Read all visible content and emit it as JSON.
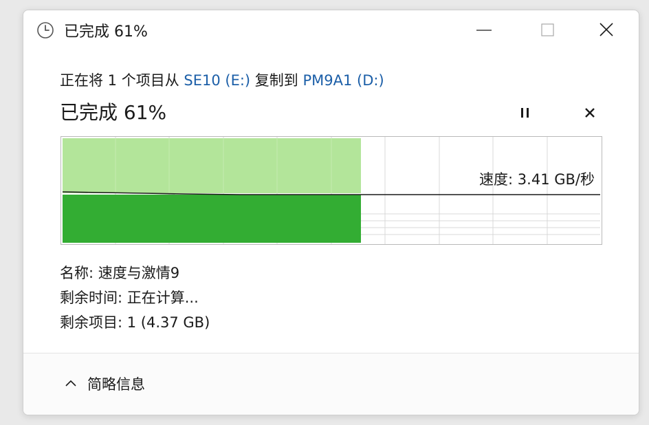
{
  "window": {
    "title": "已完成 61%",
    "controls": {
      "minimize": "minimize-icon",
      "maximize": "maximize-icon",
      "close": "close-icon"
    }
  },
  "copy": {
    "prefix": "正在将 1 个项目从 ",
    "source": "SE10 (E:)",
    "middle": " 复制到 ",
    "destination": "PM9A1 (D:)"
  },
  "progress": {
    "label": "已完成 61%",
    "percent": 61
  },
  "graph": {
    "speed_label": "速度: 3.41 GB/秒",
    "colors": {
      "fill_light": "#b3e59a",
      "fill_dark": "#33ad33",
      "grid": "#d9d9d9",
      "speed_line": "#1a1a1a"
    }
  },
  "details": {
    "name": "名称: 速度与激情9",
    "time_remaining": "剩余时间: 正在计算...",
    "items_remaining": "剩余项目: 1 (4.37 GB)"
  },
  "footer": {
    "toggle_label": "简略信息",
    "toggle_icon": "chevron-up-icon"
  },
  "icons": {
    "title": "clock-icon",
    "pause": "pause-icon",
    "cancel": "cancel-icon"
  }
}
